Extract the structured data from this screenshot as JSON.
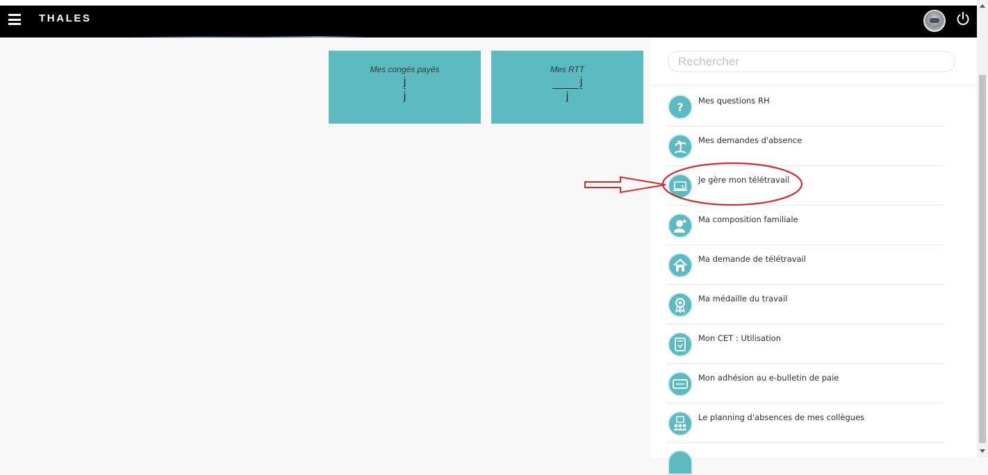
{
  "header": {
    "logo": "THALES"
  },
  "tiles": [
    {
      "title": "Mes congés payés",
      "value1": "j",
      "value2": "j"
    },
    {
      "title": "Mes RTT",
      "value1": "j",
      "value2": "j"
    }
  ],
  "search": {
    "placeholder": "Rechercher"
  },
  "menu": {
    "items": [
      {
        "label": "Mes questions RH",
        "icon": "question-icon"
      },
      {
        "label": "Mes demandes d'absence",
        "icon": "beach-icon"
      },
      {
        "label": "Je gère mon télétravail",
        "icon": "laptop-icon"
      },
      {
        "label": "Ma composition familiale",
        "icon": "family-icon"
      },
      {
        "label": "Ma demande de télétravail",
        "icon": "house-icon"
      },
      {
        "label": "Ma médaille du travail",
        "icon": "medal-icon"
      },
      {
        "label": "Mon CET : Utilisation",
        "icon": "tablet-icon"
      },
      {
        "label": "Mon adhésion au e-bulletin de paie",
        "icon": "monitor-icon"
      },
      {
        "label": "Le planning d'absences de mes collègues",
        "icon": "team-calendar-icon"
      }
    ]
  },
  "colors": {
    "accent": "#5cbbc1",
    "header": "#000000",
    "annotation": "#d42a2a"
  }
}
